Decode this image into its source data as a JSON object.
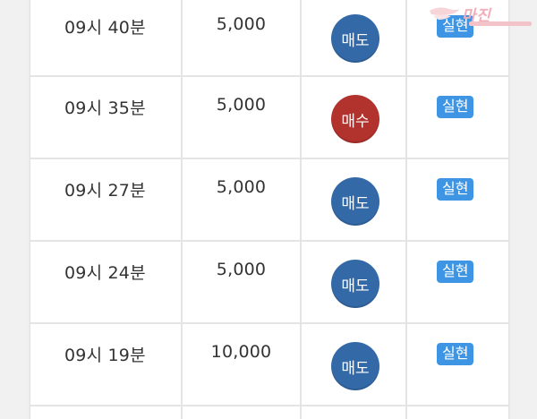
{
  "rows": [
    {
      "time": "09시 40분",
      "amount": "5,000",
      "type_label": "매도",
      "type": "sell",
      "status": "실현"
    },
    {
      "time": "09시 35분",
      "amount": "5,000",
      "type_label": "매수",
      "type": "buy",
      "status": "실현"
    },
    {
      "time": "09시 27분",
      "amount": "5,000",
      "type_label": "매도",
      "type": "sell",
      "status": "실현"
    },
    {
      "time": "09시 24분",
      "amount": "5,000",
      "type_label": "매도",
      "type": "sell",
      "status": "실현"
    },
    {
      "time": "09시 19분",
      "amount": "10,000",
      "type_label": "매도",
      "type": "sell",
      "status": "실현"
    }
  ],
  "colors": {
    "sell": "#3469a7",
    "buy": "#b2322d",
    "status_badge": "#3d95e4",
    "watermark": "#f2aeb8"
  },
  "watermark": {
    "text": "마진"
  }
}
